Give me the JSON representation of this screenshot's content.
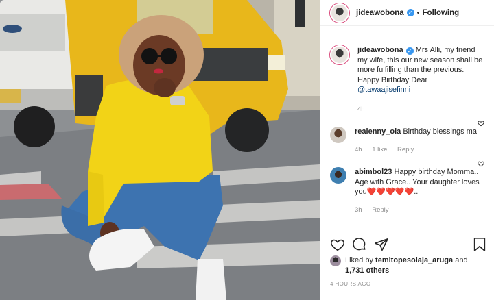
{
  "post": {
    "author": "jideawobona",
    "follow_state": "Following",
    "caption_author": "jideawobona",
    "caption_text": "Mrs Alli, my friend my wife, this our new season shall be more fulfilling than the previous.",
    "caption_line2": "Happy Birthday Dear",
    "caption_mention": "@tawaajisefinni",
    "caption_time": "4h"
  },
  "comments": [
    {
      "user": "realenny_ola",
      "text": "Birthday blessings ma",
      "time": "4h",
      "likes": "1 like",
      "reply": "Reply"
    },
    {
      "user": "abimbol23",
      "text": "Happy birthday Momma.. Age with Grace.. Your daughter loves you❤️❤️❤️❤️❤️..",
      "time": "3h",
      "reply": "Reply"
    }
  ],
  "likes": {
    "prefix": "Liked by",
    "liker": "temitopesolaja_aruga",
    "and": "and",
    "others": "1,731 others"
  },
  "timestamp": "4 HOURS AGO",
  "icons": {
    "verified": "verified-badge-icon",
    "more": "more-options-icon",
    "heart": "heart-icon",
    "comment": "comment-icon",
    "share": "share-icon",
    "save": "bookmark-icon"
  }
}
